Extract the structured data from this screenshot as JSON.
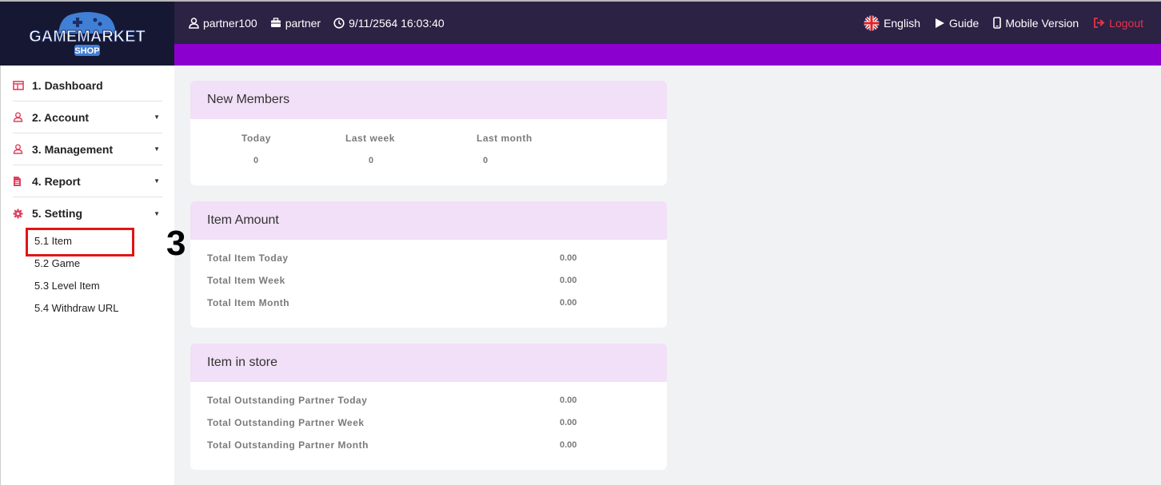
{
  "logo": {
    "line1": "GAMEMARKET",
    "line2": "SHOP"
  },
  "header": {
    "username": "partner100",
    "role": "partner",
    "datetime": "9/11/2564 16:03:40",
    "language": "English",
    "guide": "Guide",
    "mobile": "Mobile Version",
    "logout": "Logout"
  },
  "sidebar": {
    "items": [
      {
        "label": "1. Dashboard",
        "icon": "dashboard-icon"
      },
      {
        "label": "2. Account",
        "icon": "user-icon"
      },
      {
        "label": "3. Management",
        "icon": "user-icon"
      },
      {
        "label": "4. Report",
        "icon": "document-icon"
      },
      {
        "label": "5. Setting",
        "icon": "gear-icon"
      }
    ],
    "setting_sub": [
      "5.1 Item",
      "5.2 Game",
      "5.3 Level Item",
      "5.4 Withdraw URL"
    ]
  },
  "annotation": {
    "step": "3"
  },
  "new_members": {
    "title": "New Members",
    "headers": [
      "Today",
      "Last week",
      "Last month"
    ],
    "values": [
      "0",
      "0",
      "0"
    ]
  },
  "item_amount": {
    "title": "Item Amount",
    "rows": [
      {
        "label": "Total Item Today",
        "value": "0.00"
      },
      {
        "label": "Total Item Week",
        "value": "0.00"
      },
      {
        "label": "Total Item Month",
        "value": "0.00"
      }
    ]
  },
  "item_store": {
    "title": "Item in store",
    "rows": [
      {
        "label": "Total Outstanding Partner Today",
        "value": "0.00"
      },
      {
        "label": "Total Outstanding Partner Week",
        "value": "0.00"
      },
      {
        "label": "Total Outstanding Partner Month",
        "value": "0.00"
      }
    ]
  },
  "colors": {
    "header_bg": "#2b2244",
    "accent_bar": "#8c00cf",
    "card_header": "#f1e0f7",
    "logout": "#e8334a",
    "highlight": "#e01515"
  }
}
